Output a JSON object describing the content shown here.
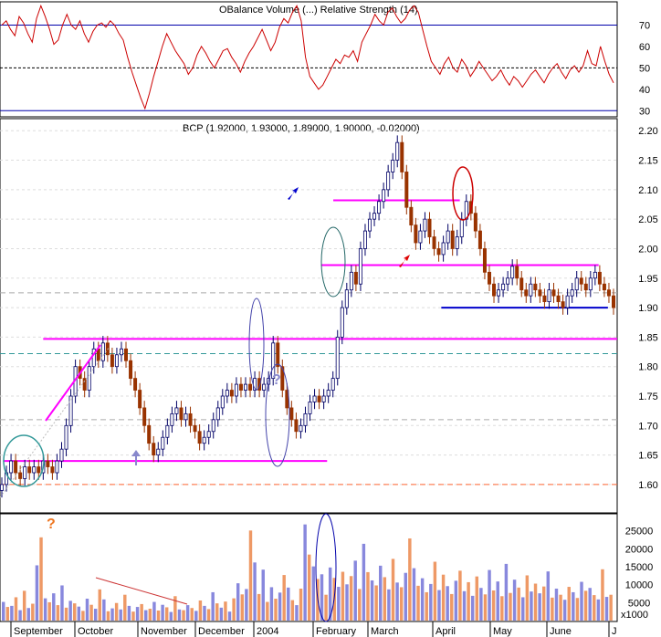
{
  "rsi_panel": {
    "title": "OBalance Volume (...)  Relative Strength (14)",
    "ticks": [
      30,
      40,
      50,
      60,
      70
    ],
    "ylim": [
      28,
      80
    ],
    "levels": [
      30,
      50,
      70
    ],
    "values": [
      70,
      72,
      68,
      65,
      74,
      71,
      66,
      62,
      73,
      79,
      74,
      68,
      61,
      63,
      70,
      75,
      70,
      68,
      72,
      66,
      62,
      67,
      70,
      71,
      69,
      72,
      70,
      66,
      63,
      55,
      48,
      42,
      36,
      31,
      38,
      46,
      53,
      60,
      66,
      62,
      58,
      55,
      52,
      47,
      50,
      56,
      60,
      57,
      53,
      50,
      54,
      58,
      59,
      55,
      52,
      48,
      53,
      57,
      60,
      64,
      68,
      63,
      58,
      62,
      69,
      73,
      71,
      76,
      79,
      72,
      55,
      46,
      43,
      40,
      42,
      46,
      50,
      54,
      52,
      56,
      55,
      58,
      53,
      62,
      66,
      70,
      75,
      72,
      70,
      76,
      78,
      74,
      71,
      73,
      77,
      79,
      76,
      68,
      60,
      53,
      50,
      47,
      52,
      55,
      50,
      48,
      54,
      51,
      46,
      49,
      53,
      50,
      47,
      44,
      46,
      49,
      45,
      42,
      46,
      44,
      41,
      44,
      47,
      49,
      46,
      43,
      47,
      50,
      52,
      48,
      45,
      49,
      51,
      48,
      51,
      58,
      52,
      51,
      60,
      53,
      47,
      43
    ],
    "color": "#cc0000"
  },
  "price_panel": {
    "title": "BCP (1.92000, 1.93000, 1.89000, 1.90000, -0.02000)",
    "ticks": [
      1.6,
      1.65,
      1.7,
      1.75,
      1.8,
      1.85,
      1.9,
      1.95,
      2.0,
      2.05,
      2.1,
      2.15,
      2.2
    ],
    "tick_labels": [
      "1.60",
      "1.65",
      "1.70",
      "1.75",
      "1.80",
      "1.85",
      "1.90",
      "1.95",
      "2.00",
      "2.05",
      "2.10",
      "2.15",
      "2.20"
    ],
    "ylim": [
      1.555,
      2.205
    ],
    "closes": [
      1.6,
      1.62,
      1.64,
      1.62,
      1.61,
      1.63,
      1.62,
      1.63,
      1.62,
      1.64,
      1.63,
      1.62,
      1.64,
      1.66,
      1.7,
      1.75,
      1.8,
      1.78,
      1.76,
      1.8,
      1.83,
      1.81,
      1.84,
      1.82,
      1.8,
      1.82,
      1.83,
      1.81,
      1.78,
      1.76,
      1.73,
      1.7,
      1.67,
      1.65,
      1.66,
      1.68,
      1.7,
      1.72,
      1.73,
      1.71,
      1.72,
      1.7,
      1.69,
      1.67,
      1.68,
      1.69,
      1.71,
      1.73,
      1.75,
      1.76,
      1.75,
      1.77,
      1.76,
      1.77,
      1.76,
      1.78,
      1.76,
      1.77,
      1.78,
      1.84,
      1.8,
      1.76,
      1.73,
      1.71,
      1.69,
      1.7,
      1.72,
      1.74,
      1.75,
      1.74,
      1.75,
      1.76,
      1.78,
      1.85,
      1.9,
      1.93,
      1.96,
      1.94,
      2.0,
      2.03,
      2.05,
      2.06,
      2.08,
      2.1,
      2.13,
      2.15,
      2.18,
      2.13,
      2.07,
      2.04,
      2.01,
      2.03,
      2.05,
      2.02,
      2.0,
      1.99,
      2.01,
      2.03,
      2.0,
      2.02,
      2.05,
      2.08,
      2.06,
      2.03,
      2.0,
      1.96,
      1.94,
      1.92,
      1.93,
      1.94,
      1.95,
      1.97,
      1.95,
      1.93,
      1.92,
      1.94,
      1.93,
      1.92,
      1.91,
      1.93,
      1.92,
      1.91,
      1.9,
      1.92,
      1.93,
      1.95,
      1.94,
      1.93,
      1.95,
      1.96,
      1.94,
      1.93,
      1.92,
      1.9
    ],
    "hlines_solid": [
      {
        "y": 1.64,
        "x0": 0.005,
        "x1": 0.53,
        "color": "#ff00ff"
      },
      {
        "y": 1.847,
        "x0": 0.07,
        "x1": 1.0,
        "color": "#ff00ff"
      },
      {
        "y": 1.972,
        "x0": 0.52,
        "x1": 0.97,
        "color": "#ff00ff"
      },
      {
        "y": 2.082,
        "x0": 0.54,
        "x1": 0.745,
        "color": "#ff00ff"
      },
      {
        "y": 1.9,
        "x0": 0.715,
        "x1": 0.985,
        "color": "#0000cc"
      }
    ],
    "hlines_dashed": [
      {
        "y": 1.6,
        "color": "#ff6633"
      },
      {
        "y": 1.822,
        "color": "#339999"
      },
      {
        "y": 1.71,
        "color": "#aaaaaa"
      },
      {
        "y": 1.925,
        "color": "#aaaaaa"
      }
    ],
    "accent_up": "#ffffff",
    "accent_down": "#993300"
  },
  "volume_panel": {
    "unit": "x1000",
    "ticks": [
      5000,
      10000,
      15000,
      20000,
      25000
    ],
    "tick_labels": [
      "5000",
      "10000",
      "15000",
      "20000",
      "25000"
    ],
    "ylim": [
      0,
      29000
    ],
    "colors": [
      "#8888dd",
      "#ee9966"
    ],
    "values": [
      5200,
      3800,
      4100,
      6500,
      2900,
      8300,
      3500,
      4700,
      15400,
      23200,
      6200,
      5100,
      7600,
      4300,
      9800,
      3600,
      5500,
      4800,
      3900,
      2700,
      6100,
      4400,
      3300,
      8700,
      5900,
      2600,
      3400,
      4900,
      3100,
      7200,
      4100,
      2500,
      3800,
      4600,
      2900,
      3300,
      5200,
      2800,
      4400,
      3700,
      2400,
      6800,
      3100,
      2900,
      4300,
      3500,
      2700,
      5600,
      4100,
      3200,
      7900,
      4800,
      3600,
      5300,
      2500,
      6200,
      10400,
      7300,
      8800,
      25100,
      16200,
      7400,
      14200,
      5200,
      9300,
      6100,
      7800,
      12700,
      9200,
      5700,
      4300,
      8900,
      26800,
      18400,
      15100,
      11600,
      12900,
      7200,
      14800,
      11900,
      9400,
      13600,
      10100,
      12400,
      16700,
      8800,
      21400,
      13500,
      11200,
      9800,
      15300,
      12100,
      8700,
      17200,
      10600,
      9300,
      13300,
      22900,
      14600,
      9700,
      11800,
      7900,
      10200,
      16400,
      8500,
      12800,
      9600,
      7400,
      11100,
      13900,
      8200,
      10700,
      6900,
      12300,
      9100,
      7300,
      14100,
      8400,
      10900,
      6800,
      15800,
      7700,
      11400,
      9200,
      6500,
      12600,
      8100,
      10300,
      7600,
      9500,
      13700,
      6400,
      8900,
      7200,
      5800,
      9400,
      7900,
      6300,
      10800,
      8300,
      9100,
      7100,
      5900,
      14300,
      6600,
      7200
    ],
    "annotation_top": "?"
  },
  "x_axis": {
    "months": [
      "September",
      "October",
      "November",
      "December",
      "2004",
      "February",
      "March",
      "April",
      "May",
      "June",
      "J"
    ]
  },
  "annotations": {
    "question_mark_price": "?",
    "question_mark_volume": "?"
  }
}
